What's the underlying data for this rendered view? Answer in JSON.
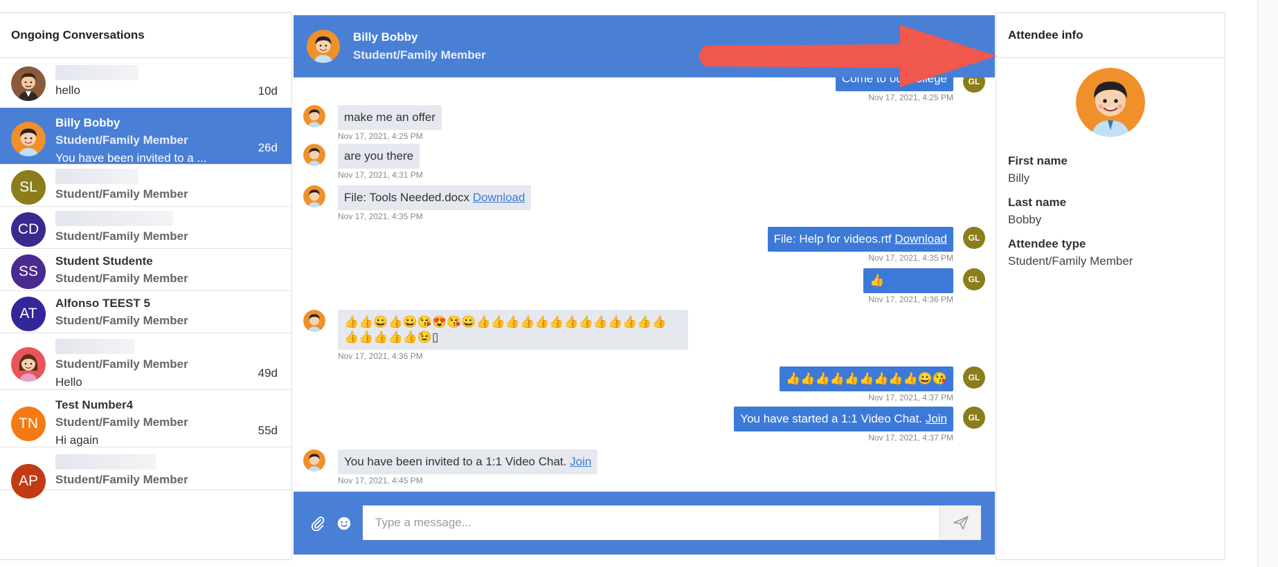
{
  "left_panel": {
    "title": "Ongoing Conversations",
    "conversations": [
      {
        "initials": "",
        "name": "",
        "role": "",
        "message": "hello",
        "time": "10d",
        "avatar_color": "#8a5a3c"
      },
      {
        "initials": "",
        "name": "Billy Bobby",
        "role": "Student/Family Member",
        "message": "You have been invited to a ...",
        "time": "26d",
        "avatar_color": "#f0902a"
      },
      {
        "initials": "SL",
        "name": "",
        "role": "Student/Family Member",
        "message": "",
        "time": "",
        "avatar_color": "#8a7d1a"
      },
      {
        "initials": "CD",
        "name": "",
        "role": "Student/Family Member",
        "message": "",
        "time": "",
        "avatar_color": "#3a2a8e"
      },
      {
        "initials": "SS",
        "name": "Student Studente",
        "role": "Student/Family Member",
        "message": "",
        "time": "",
        "avatar_color": "#4a2a90"
      },
      {
        "initials": "AT",
        "name": "Alfonso TEEST 5",
        "role": "Student/Family Member",
        "message": "",
        "time": "",
        "avatar_color": "#32279a"
      },
      {
        "initials": "",
        "name": "",
        "role": "Student/Family Member",
        "message": "Hello",
        "time": "49d",
        "avatar_color": "#e9545a"
      },
      {
        "initials": "TN",
        "name": "Test Number4",
        "role": "Student/Family Member",
        "message": "Hi again",
        "time": "55d",
        "avatar_color": "#f57a12"
      },
      {
        "initials": "AP",
        "name": "",
        "role": "Student/Family Member",
        "message": "",
        "time": "",
        "avatar_color": "#c43a12"
      }
    ]
  },
  "chat": {
    "header": {
      "name": "Billy Bobby",
      "role": "Student/Family Member"
    },
    "user_initials": "GL",
    "messages": [
      {
        "dir": "out",
        "text": "Come to our college",
        "time": "Nov 17, 2021, 4:25 PM"
      },
      {
        "dir": "in",
        "text": "make me an offer",
        "time": "Nov 17, 2021, 4:25 PM"
      },
      {
        "dir": "in",
        "text": "are you there",
        "time": "Nov 17, 2021, 4:31 PM"
      },
      {
        "dir": "in",
        "text": "File: Tools Needed.docx",
        "link": "Download",
        "time": "Nov 17, 2021, 4:35 PM"
      },
      {
        "dir": "out",
        "text": "File: Help for videos.rtf",
        "link": "Download",
        "time": "Nov 17, 2021, 4:35 PM"
      },
      {
        "dir": "out",
        "text": "👍",
        "time": "Nov 17, 2021, 4:36 PM"
      },
      {
        "dir": "in",
        "text_line1": "👍👍😀👍😀😘😍😘😀👍👍👍👍👍👍👍👍👍👍👍👍👍",
        "text_line2": "👍👍👍👍👍😉▯",
        "time": "Nov 17, 2021, 4:36 PM"
      },
      {
        "dir": "out",
        "text": "👍👍👍👍👍👍👍👍👍😀😘",
        "time": "Nov 17, 2021, 4:37 PM"
      },
      {
        "dir": "out",
        "text": "You have started a 1:1 Video Chat.",
        "link": "Join",
        "time": "Nov 17, 2021, 4:37 PM"
      },
      {
        "dir": "in",
        "text": "You have been invited to a 1:1 Video Chat.",
        "link": "Join",
        "time": "Nov 17, 2021, 4:45 PM"
      }
    ],
    "composer": {
      "placeholder": "Type a message..."
    }
  },
  "attendee": {
    "title": "Attendee info",
    "first_name_label": "First name",
    "first_name": "Billy",
    "last_name_label": "Last name",
    "last_name": "Bobby",
    "type_label": "Attendee type",
    "type": "Student/Family Member"
  },
  "colors": {
    "accent": "#4a7fd6",
    "bubble_out": "#3d7ad8",
    "bubble_in": "#e6e8f0",
    "arrow": "#f0584e"
  }
}
